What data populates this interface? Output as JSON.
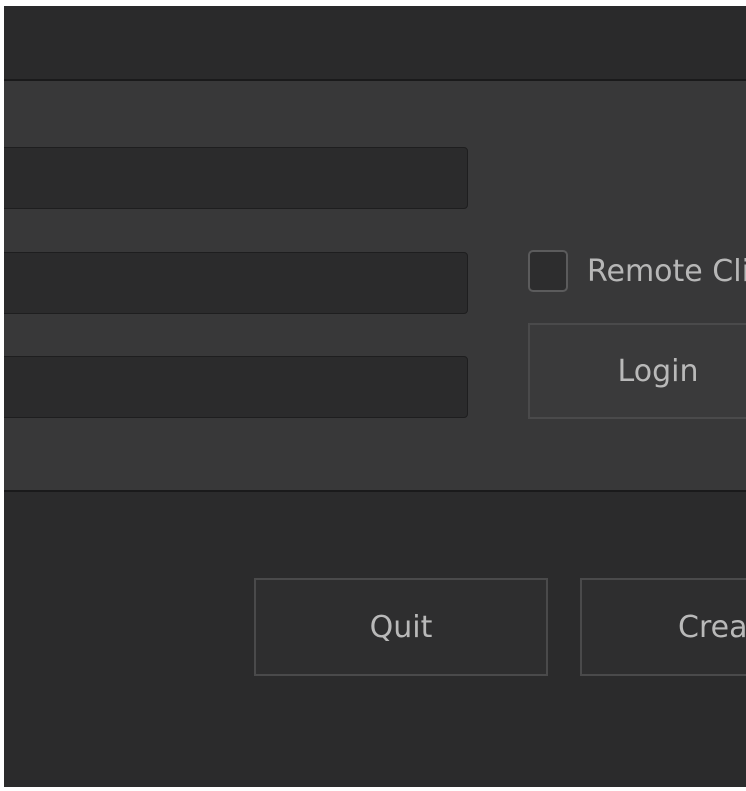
{
  "login_form": {
    "fields": [
      {
        "value": "",
        "placeholder": ""
      },
      {
        "value": "",
        "placeholder": ""
      },
      {
        "value": "",
        "placeholder": ""
      }
    ],
    "remote_client_label": "Remote Cli",
    "remote_client_checked": false,
    "login_label": "Login"
  },
  "actions": {
    "quit_label": "Quit",
    "create_label": "Crea"
  }
}
